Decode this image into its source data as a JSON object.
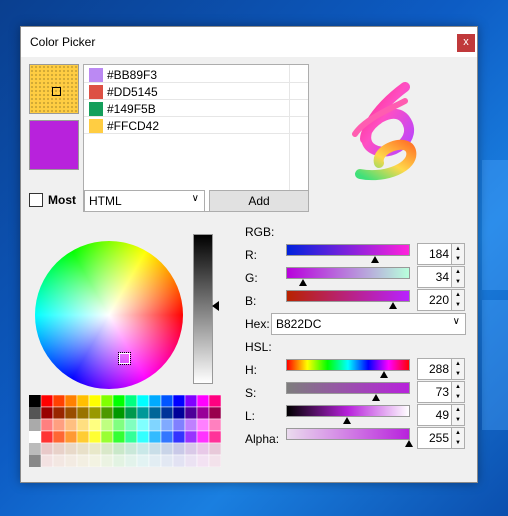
{
  "window": {
    "title": "Color Picker",
    "close_label": "x"
  },
  "colors": {
    "current": "#B822DC",
    "primary_swatch": "#FFCD42",
    "list": [
      {
        "hex": "#BB89F3",
        "color": "#BB89F3"
      },
      {
        "hex": "#DD5145",
        "color": "#DD5145"
      },
      {
        "hex": "#149F5B",
        "color": "#149F5B"
      },
      {
        "hex": "#FFCD42",
        "color": "#FFCD42"
      }
    ]
  },
  "controls": {
    "most_label": "Most",
    "format_value": "HTML",
    "add_label": "Add"
  },
  "rgb": {
    "section_label": "RGB:",
    "r": {
      "label": "R:",
      "value": "184"
    },
    "g": {
      "label": "G:",
      "value": "34"
    },
    "b": {
      "label": "B:",
      "value": "220"
    }
  },
  "hex": {
    "label": "Hex:",
    "value": "B822DC"
  },
  "hsl": {
    "section_label": "HSL:",
    "h": {
      "label": "H:",
      "value": "288"
    },
    "s": {
      "label": "S:",
      "value": "73"
    },
    "l": {
      "label": "L:",
      "value": "49"
    }
  },
  "alpha": {
    "label": "Alpha:",
    "value": "255"
  },
  "icons": {
    "close": "close-icon",
    "dropdown": "chevron-down-icon",
    "spin_up": "spin-up-icon",
    "spin_down": "spin-down-icon"
  }
}
